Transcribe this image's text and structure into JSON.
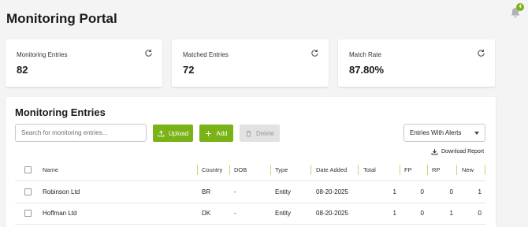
{
  "page": {
    "title": "Monitoring Portal"
  },
  "notifications": {
    "count": "4"
  },
  "cards": [
    {
      "label": "Monitoring Entries",
      "value": "82"
    },
    {
      "label": "Matched Entries",
      "value": "72"
    },
    {
      "label": "Match Rate",
      "value": "87.80%"
    }
  ],
  "panel": {
    "title": "Monitoring Entries",
    "search_placeholder": "Search for monitoring entries...",
    "upload_label": "Upload",
    "add_label": "Add",
    "delete_label": "Delete",
    "filter_selected": "Entries With Alerts",
    "download_label": "Download Report"
  },
  "table": {
    "columns": [
      "Name",
      "Country",
      "DOB",
      "Type",
      "Date Added",
      "Total",
      "FP",
      "RP",
      "New"
    ],
    "rows": [
      {
        "name": "Robinson Ltd",
        "country": "BR",
        "dob": "-",
        "type": "Entity",
        "date_added": "08-20-2025",
        "total": "1",
        "fp": "0",
        "rp": "0",
        "new": "1"
      },
      {
        "name": "Hoffman Ltd",
        "country": "DK",
        "dob": "-",
        "type": "Entity",
        "date_added": "08-20-2025",
        "total": "1",
        "fp": "0",
        "rp": "1",
        "new": "0"
      }
    ]
  },
  "colors": {
    "accent": "#7ab317",
    "disabled": "#e2e2e2"
  }
}
